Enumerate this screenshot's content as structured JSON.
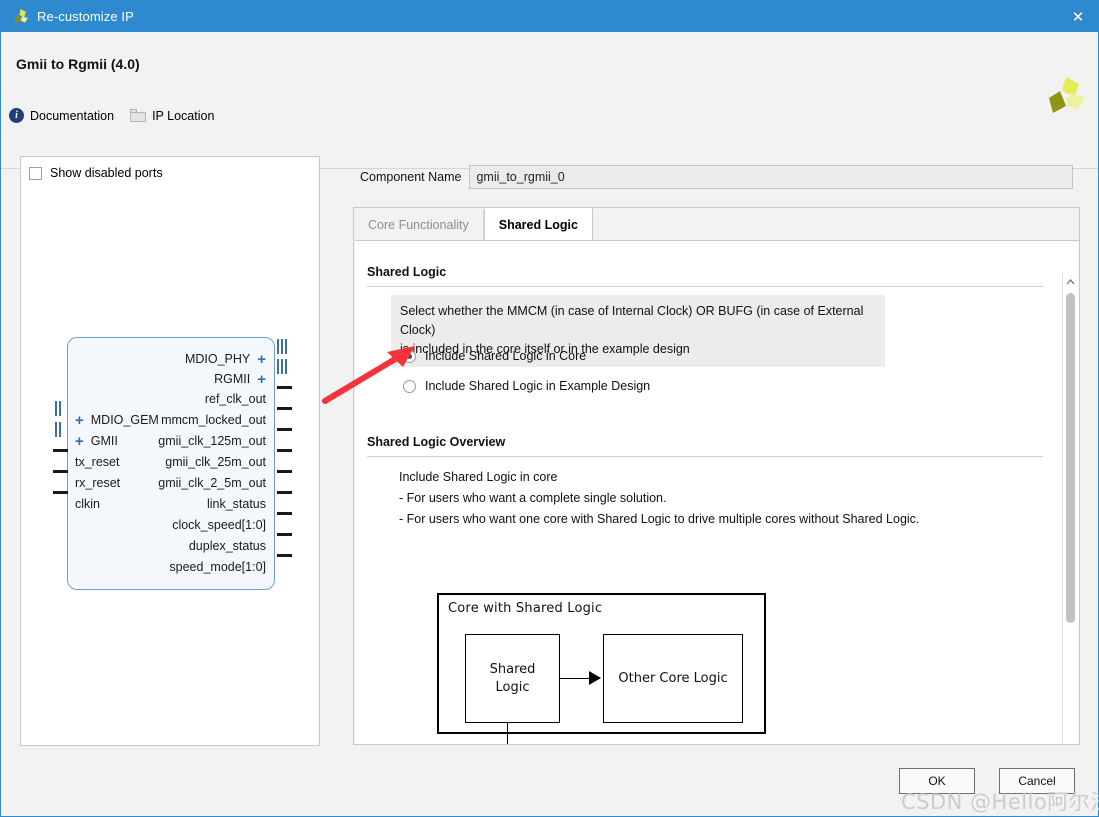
{
  "window": {
    "title": "Re-customize IP",
    "icon": "xilinx-propeller-icon",
    "close_label": "✕",
    "accent_color": "#2e89ce"
  },
  "header": {
    "title": "Gmii to Rgmii (4.0)",
    "logo": "xilinx-propeller-logo",
    "links": [
      {
        "label": "Documentation",
        "icon": "info-icon"
      },
      {
        "label": "IP Location",
        "icon": "folder-icon"
      }
    ]
  },
  "ports_panel": {
    "show_disabled_ports_label": "Show disabled ports",
    "show_disabled_ports_checked": false,
    "symbol": {
      "right_bus_ports": [
        "MDIO_PHY",
        "RGMII"
      ],
      "right_ports": [
        "ref_clk_out",
        "mmcm_locked_out",
        "gmii_clk_125m_out",
        "gmii_clk_25m_out",
        "gmii_clk_2_5m_out",
        "link_status",
        "clock_speed[1:0]",
        "duplex_status",
        "speed_mode[1:0]"
      ],
      "left_bus_ports": [
        "MDIO_GEM",
        "GMII"
      ],
      "left_ports": [
        "tx_reset",
        "rx_reset",
        "clkin"
      ]
    }
  },
  "component_name": {
    "label": "Component Name",
    "value": "gmii_to_rgmii_0"
  },
  "tabs": [
    {
      "label": "Core Functionality",
      "active": false
    },
    {
      "label": "Shared Logic",
      "active": true
    }
  ],
  "shared_logic": {
    "section_title": "Shared Logic",
    "info_line1": "Select whether the MMCM (in case of Internal Clock) OR BUFG (in case of External Clock)",
    "info_line2": "is included in the core itself or in the example design",
    "options": [
      {
        "label": "Include Shared Logic in Core",
        "selected": true
      },
      {
        "label": "Include Shared Logic in Example Design",
        "selected": false
      }
    ]
  },
  "overview": {
    "section_title": "Shared Logic Overview",
    "line1": "Include Shared Logic in core",
    "line2": "- For users who want a complete single solution.",
    "line3": "- For users who want one core with Shared Logic to drive multiple cores without Shared Logic."
  },
  "schematic": {
    "outer_label": "Core with Shared Logic",
    "left_box": "Shared\nLogic",
    "left_box_line1": "Shared",
    "left_box_line2": "Logic",
    "right_box": "Other Core Logic"
  },
  "scrollbar": {
    "up_arrow": "▲",
    "down_arrow": "▼"
  },
  "footer": {
    "ok_label": "OK",
    "cancel_label": "Cancel"
  },
  "watermark": {
    "text": "CSDN @Hello阿尔法"
  }
}
